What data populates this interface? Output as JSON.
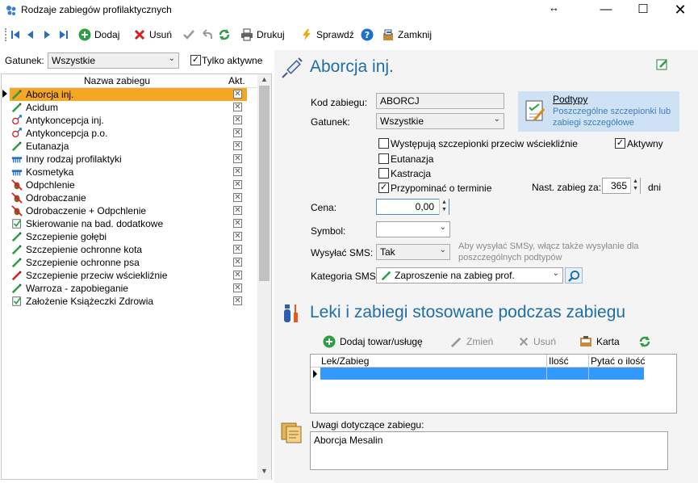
{
  "window": {
    "title": "Rodzaje zabiegów profilaktycznych"
  },
  "toolbar": {
    "add": "Dodaj",
    "delete": "Usuń",
    "print": "Drukuj",
    "check": "Sprawdź",
    "close": "Zamknij"
  },
  "filter": {
    "gatunek_label": "Gatunek:",
    "gatunek_value": "Wszystkie",
    "only_active_label": "Tylko aktywne",
    "only_active_checked": true
  },
  "list": {
    "col_name": "Nazwa zabiegu",
    "col_active": "Akt.",
    "items": [
      {
        "name": "Aborcja inj.",
        "icon": "syringe-icon",
        "selected": true
      },
      {
        "name": "Acidum",
        "icon": "syringe-icon"
      },
      {
        "name": "Antykoncepcja inj.",
        "icon": "contraception-icon"
      },
      {
        "name": "Antykoncepcja p.o.",
        "icon": "contraception-icon"
      },
      {
        "name": "Eutanazja",
        "icon": "syringe-icon"
      },
      {
        "name": "Inny rodzaj profilaktyki",
        "icon": "comb-icon"
      },
      {
        "name": "Kosmetyka",
        "icon": "comb-icon"
      },
      {
        "name": "Odpchlenie",
        "icon": "antiparasite-icon"
      },
      {
        "name": "Odrobaczanie",
        "icon": "antiparasite-icon"
      },
      {
        "name": "Odrobaczenie + Odpchlenie",
        "icon": "antiparasite-icon"
      },
      {
        "name": "Skierowanie na bad. dodatkowe",
        "icon": "checklist-icon"
      },
      {
        "name": "Szczepienie gołębi",
        "icon": "syringe-icon"
      },
      {
        "name": "Szczepienie ochronne kota",
        "icon": "syringe-icon"
      },
      {
        "name": "Szczepienie ochronne psa",
        "icon": "syringe-icon"
      },
      {
        "name": "Szczepienie przeciw wściekliźnie",
        "icon": "syringe-red-icon"
      },
      {
        "name": "Warroza - zapobieganie",
        "icon": "syringe-icon"
      },
      {
        "name": "Założenie Książeczki Zdrowia",
        "icon": "checklist-icon"
      }
    ]
  },
  "detail": {
    "title": "Aborcja inj.",
    "kod_label": "Kod zabiegu:",
    "kod_value": "ABORCJ",
    "gatunek_label": "Gatunek:",
    "gatunek_value": "Wszystkie",
    "podtypy_title": "Podtypy",
    "podtypy_desc": "Poszczególne szczepionki lub zabiegi szczegółowe",
    "chk_rabies_label": "Występują szczepionki przeciw wściekliźnie",
    "chk_rabies": false,
    "chk_active_label": "Aktywny",
    "chk_active": true,
    "chk_euthanasia_label": "Eutanazja",
    "chk_euthanasia": false,
    "chk_castration_label": "Kastracja",
    "chk_castration": false,
    "chk_reminder_label": "Przypominać o terminie",
    "chk_reminder": true,
    "next_label": "Nast. zabieg za:",
    "next_value": "365",
    "next_unit": "dni",
    "price_label": "Cena:",
    "price_value": "0,00",
    "symbol_label": "Symbol:",
    "symbol_value": "",
    "sms_label": "Wysyłać SMS:",
    "sms_value": "Tak",
    "sms_hint": "Aby wysyłać SMSy, włącz także wysyłanie dla poszczególnych podtypów",
    "sms_cat_label": "Kategoria SMS:",
    "sms_cat_value": "Zaproszenie na zabieg prof."
  },
  "meds": {
    "title": "Leki i zabiegi stosowane podczas zabiegu",
    "add": "Dodaj towar/usługę",
    "change": "Zmień",
    "delete": "Usuń",
    "card": "Karta",
    "col_item": "Lek/Zabieg",
    "col_qty": "Ilość",
    "col_ask": "Pytać o ilość"
  },
  "notes": {
    "label": "Uwagi dotyczące zabiegu:",
    "value": "Aborcja Mesalin"
  },
  "colors": {
    "accent": "#1e6fa6",
    "selection": "#f5a623",
    "grid_selection": "#3399ff"
  }
}
